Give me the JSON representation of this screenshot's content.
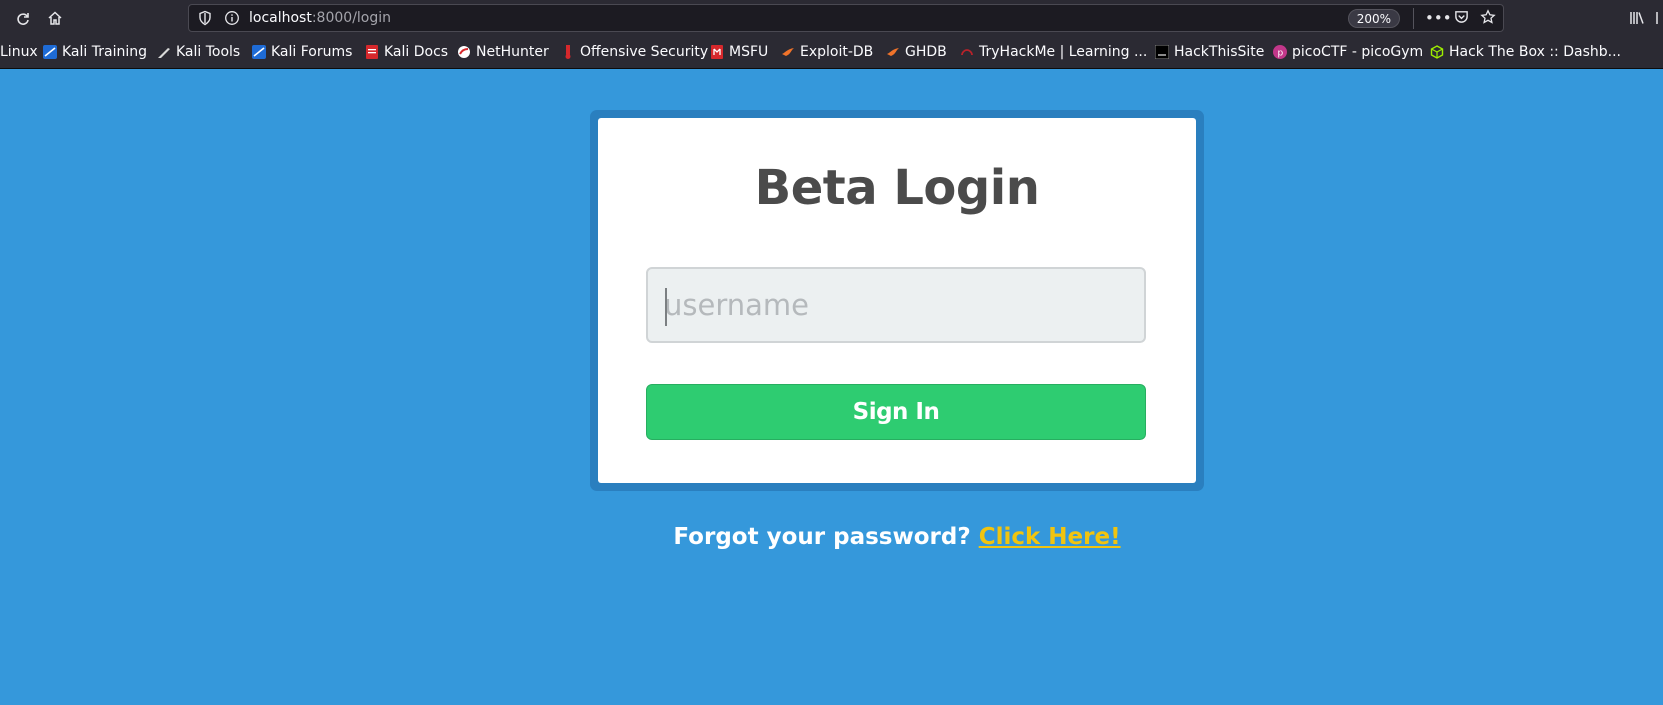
{
  "browser": {
    "url_host": "localhost",
    "url_path": ":8000/login",
    "zoom": "200%",
    "accent_color": "#2b2a33"
  },
  "bookmarks": [
    {
      "label": "Linux",
      "icon": "kali-icon"
    },
    {
      "label": "Kali Training",
      "icon": "kali-icon"
    },
    {
      "label": "Kali Tools",
      "icon": "knife-icon"
    },
    {
      "label": "Kali Forums",
      "icon": "kali-icon"
    },
    {
      "label": "Kali Docs",
      "icon": "docs-icon"
    },
    {
      "label": "NetHunter",
      "icon": "nethunter-icon"
    },
    {
      "label": "Offensive Security",
      "icon": "offsec-icon"
    },
    {
      "label": "MSFU",
      "icon": "offsec-icon"
    },
    {
      "label": "Exploit-DB",
      "icon": "exploitdb-icon"
    },
    {
      "label": "GHDB",
      "icon": "exploitdb-icon"
    },
    {
      "label": "TryHackMe | Learning ...",
      "icon": "tryhackme-icon"
    },
    {
      "label": "HackThisSite",
      "icon": "hts-icon"
    },
    {
      "label": "picoCTF - picoGym",
      "icon": "picoctf-icon"
    },
    {
      "label": "Hack The Box :: Dashb...",
      "icon": "htb-icon"
    }
  ],
  "login": {
    "title": "Beta Login",
    "username_placeholder": "username",
    "username_value": "",
    "signin_label": "Sign In",
    "forgot_text": "Forgot your password?",
    "forgot_link": "Click Here!"
  },
  "colors": {
    "background": "#3598db",
    "card_border": "#2a7fbf",
    "button": "#2ecc71",
    "link": "#f1c40f"
  }
}
